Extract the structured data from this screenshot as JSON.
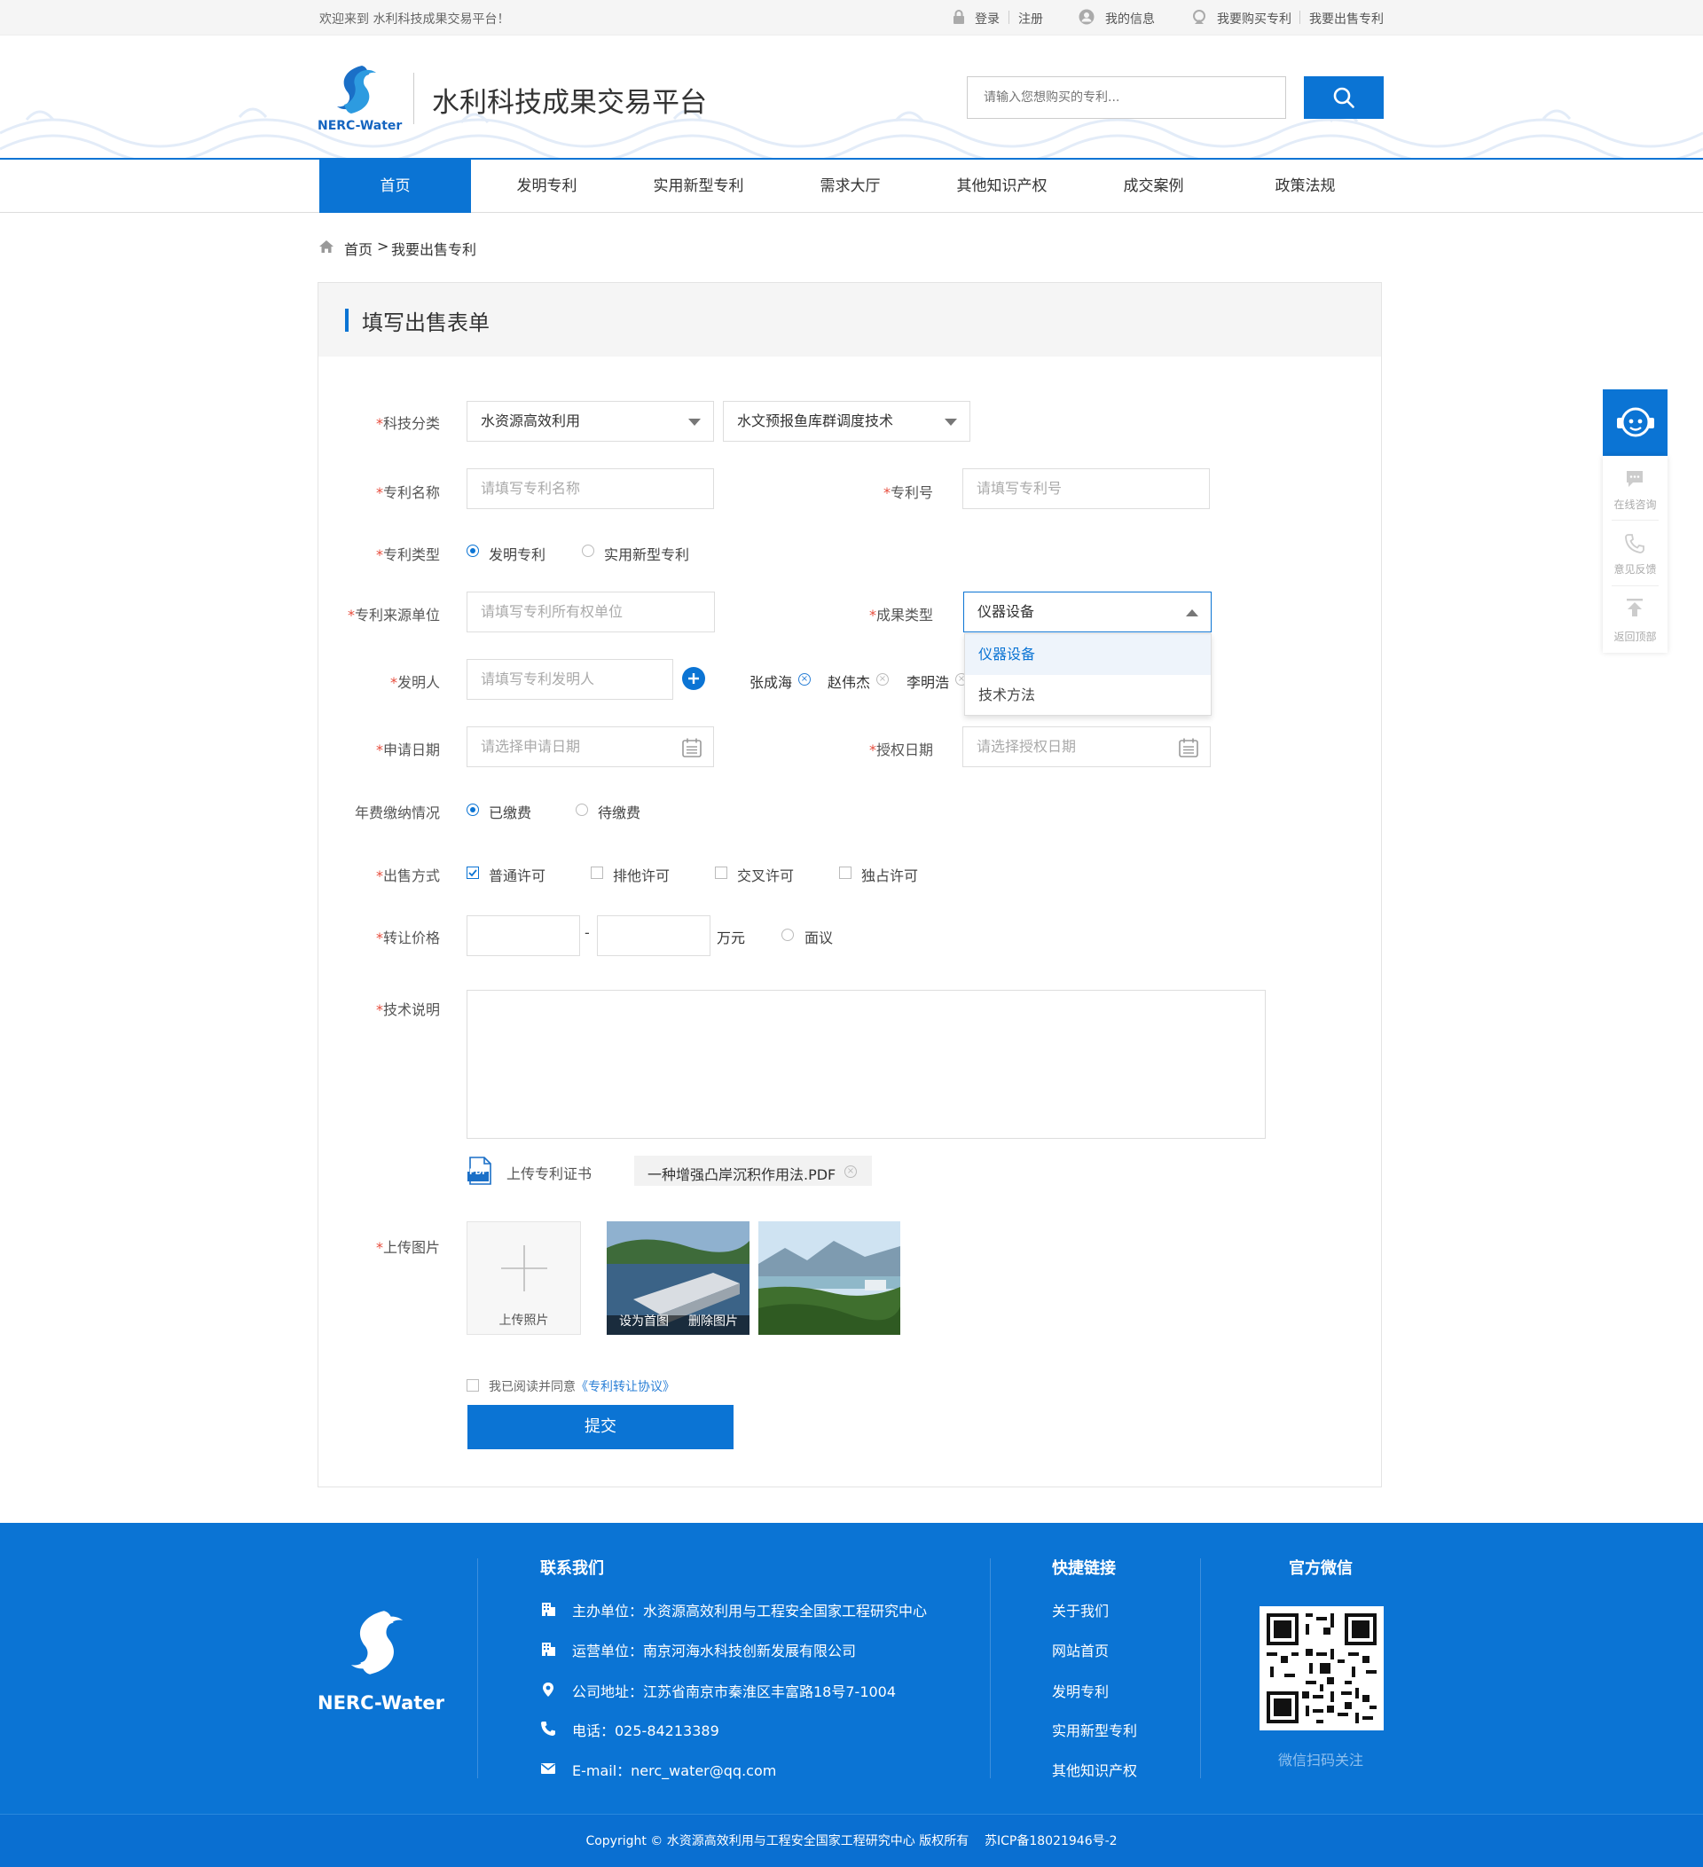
{
  "topbar": {
    "welcome": "欢迎来到 水利科技成果交易平台！",
    "login": "登录",
    "register": "注册",
    "my_info": "我的信息",
    "buy": "我要购买专利",
    "sell": "我要出售专利"
  },
  "header": {
    "logo_text": "NERC-Water",
    "site_title": "水利科技成果交易平台",
    "search_placeholder": "请输入您想购买的专利..."
  },
  "nav": [
    "首页",
    "发明专利",
    "实用新型专利",
    "需求大厅",
    "其他知识产权",
    "成交案例",
    "政策法规"
  ],
  "breadcrumb": {
    "home": "首页",
    "sep": ">",
    "current": "我要出售专利"
  },
  "form": {
    "title": "填写出售表单",
    "required_mark": "*",
    "category": {
      "label": "科技分类",
      "primary": "水资源高效利用",
      "secondary": "水文预报鱼库群调度技术"
    },
    "patent_name": {
      "label": "专利名称",
      "placeholder": "请填写专利名称"
    },
    "patent_no": {
      "label": "专利号",
      "placeholder": "请填写专利号"
    },
    "patent_type": {
      "label": "专利类型",
      "options": [
        "发明专利",
        "实用新型专利"
      ],
      "selected": "发明专利"
    },
    "source_unit": {
      "label": "专利来源单位",
      "placeholder": "请填写专利所有权单位"
    },
    "result_type": {
      "label": "成果类型",
      "value": "仪器设备",
      "options": [
        "仪器设备",
        "技术方法"
      ]
    },
    "inventor": {
      "label": "发明人",
      "placeholder": "请填写专利发明人",
      "tags": [
        "张成海",
        "赵伟杰",
        "李明浩"
      ]
    },
    "apply_date": {
      "label": "申请日期",
      "placeholder": "请选择申请日期"
    },
    "grant_date": {
      "label": "授权日期",
      "placeholder": "请选择授权日期"
    },
    "annual_fee": {
      "label": "年费缴纳情况",
      "options": [
        "已缴费",
        "待缴费"
      ],
      "selected": "已缴费"
    },
    "sale_method": {
      "label": "出售方式",
      "options": [
        "普通许可",
        "排他许可",
        "交叉许可",
        "独占许可"
      ],
      "checked": [
        "普通许可"
      ]
    },
    "price": {
      "label": "转让价格",
      "dash": "-",
      "unit": "万元",
      "negotiable": "面议"
    },
    "tech_desc": {
      "label": "技术说明"
    },
    "certificate": {
      "upload_label": "上传专利证书",
      "file": "一种增强凸岸沉积作用法.PDF",
      "pdf_badge": "PDF"
    },
    "images": {
      "label": "上传图片",
      "upload_text": "上传照片",
      "set_cover": "设为首图",
      "delete": "删除图片"
    },
    "agreement": {
      "text": "我已阅读并同意",
      "link": "《专利转让协议》"
    },
    "submit": "提交"
  },
  "side": {
    "consult": "在线咨询",
    "feedback": "意见反馈",
    "top": "返回顶部"
  },
  "footer": {
    "logo_text": "NERC-Water",
    "contact_title": "联系我们",
    "host": "主办单位：水资源高效利用与工程安全国家工程研究中心",
    "operator": "运营单位：南京河海水科技创新发展有限公司",
    "address": "公司地址：江苏省南京市秦淮区丰富路18号7-1004",
    "phone": "电话：025-84213389",
    "email": "E-mail：nerc_water@qq.com",
    "links_title": "快捷链接",
    "links": [
      "关于我们",
      "网站首页",
      "发明专利",
      "实用新型专利",
      "其他知识产权"
    ],
    "wechat_title": "官方微信",
    "wechat_caption": "微信扫码关注",
    "copyright": "Copyright © 水资源高效利用与工程安全国家工程研究中心 版权所有    苏ICP备18021946号-2"
  },
  "colors": {
    "primary": "#0b74d4",
    "required": "#e74c3c",
    "footer": "#0b74d4"
  }
}
